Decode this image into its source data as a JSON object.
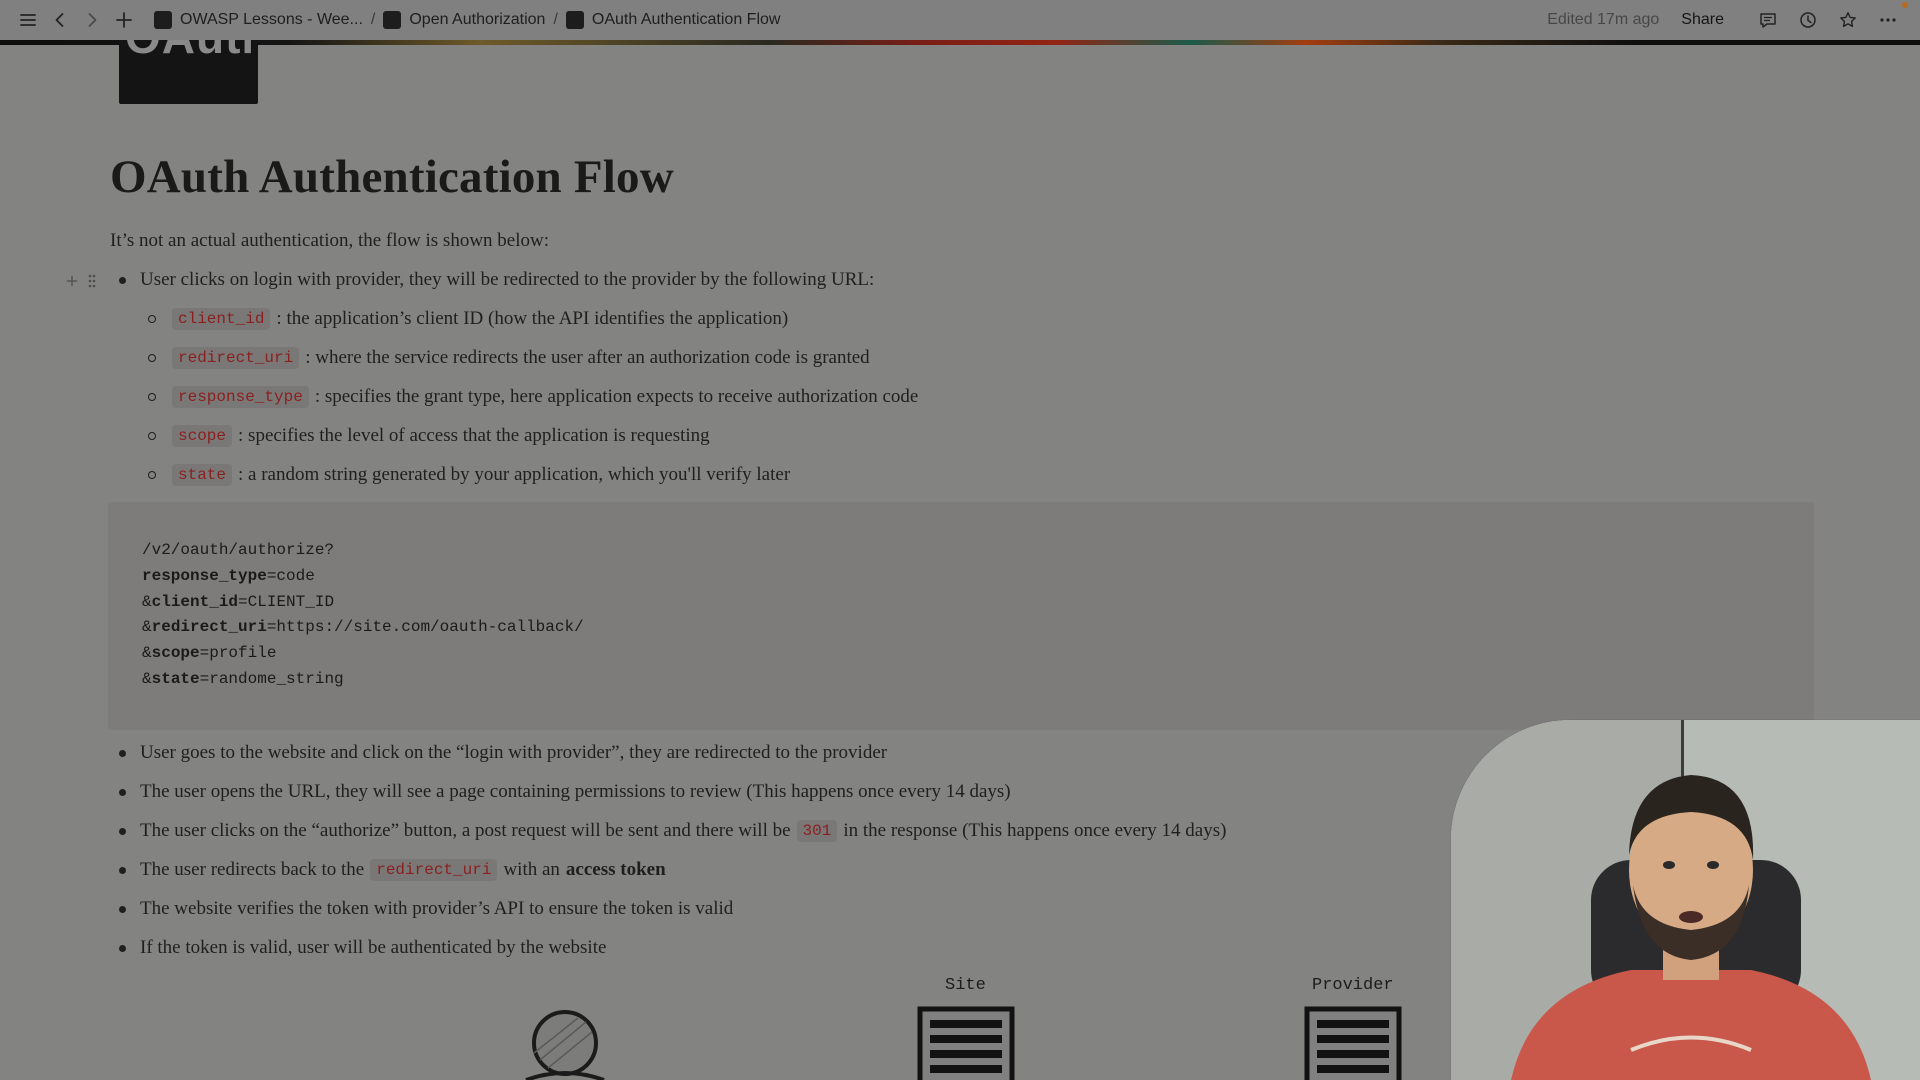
{
  "topbar": {
    "breadcrumbs": [
      {
        "label": "OWASP Lessons - Wee..."
      },
      {
        "label": "Open Authorization"
      },
      {
        "label": "OAuth Authentication Flow"
      }
    ],
    "separator": "/",
    "edited": "Edited 17m ago",
    "share_label": "Share"
  },
  "page": {
    "icon_text": "OAuth",
    "title": "OAuth Authentication Flow",
    "intro": "It’s not an actual authentication, the flow is shown below:",
    "first_bullet": "User clicks on login with provider, they will be redirected to the provider by the following URL:",
    "params": [
      {
        "code": "client_id",
        "text": ": the application’s client ID (how the API identifies the application)"
      },
      {
        "code": "redirect_uri",
        "text": ": where the service redirects the user after an authorization code is granted"
      },
      {
        "code": "response_type",
        "text": ": specifies the grant type, here application expects to receive authorization code"
      },
      {
        "code": "scope",
        "text": ": specifies the level of access that the application is requesting"
      },
      {
        "code": "state",
        "text": ": a random string generated by your application, which you'll verify later"
      }
    ],
    "code_lines": [
      {
        "prefix": "",
        "key": "",
        "rest": "/v2/oauth/authorize?"
      },
      {
        "prefix": "",
        "key": "response_type",
        "rest": "=code"
      },
      {
        "prefix": "&",
        "key": "client_id",
        "rest": "=CLIENT_ID"
      },
      {
        "prefix": "&",
        "key": "redirect_uri",
        "rest": "=https://site.com/oauth-callback/"
      },
      {
        "prefix": "&",
        "key": "scope",
        "rest": "=profile"
      },
      {
        "prefix": "&",
        "key": "state",
        "rest": "=randome_string"
      }
    ],
    "steps": {
      "s1": "User goes to the website and click on the “login with provider”, they are redirected to the provider",
      "s2": "The user opens the URL, they will see a page containing permissions to review (This happens once every 14 days)",
      "s3_before": "The user clicks on the “authorize” button, a post request will be sent and there will be",
      "s3_code": "301",
      "s3_after": "in the response (This happens once every 14 days)",
      "s4_before": "The user redirects back to the",
      "s4_code": "redirect_uri",
      "s4_mid": "with an",
      "s4_bold": "access token",
      "s5": "The website verifies the token with provider’s API to ensure the token is valid",
      "s6": "If the token is valid, user will be authenticated by the website"
    },
    "diagram": {
      "site_label": "Site",
      "provider_label": "Provider"
    }
  },
  "colors": {
    "page_bg": "#838382",
    "inline_code_text": "#8b1f1f",
    "code_block_bg": "#7d7c7b"
  },
  "icons": [
    "menu-icon",
    "back-icon",
    "forward-icon",
    "new-page-icon",
    "comment-icon",
    "history-icon",
    "star-icon",
    "more-icon",
    "plus-icon",
    "drag-handle-icon",
    "user-icon",
    "server-icon"
  ]
}
